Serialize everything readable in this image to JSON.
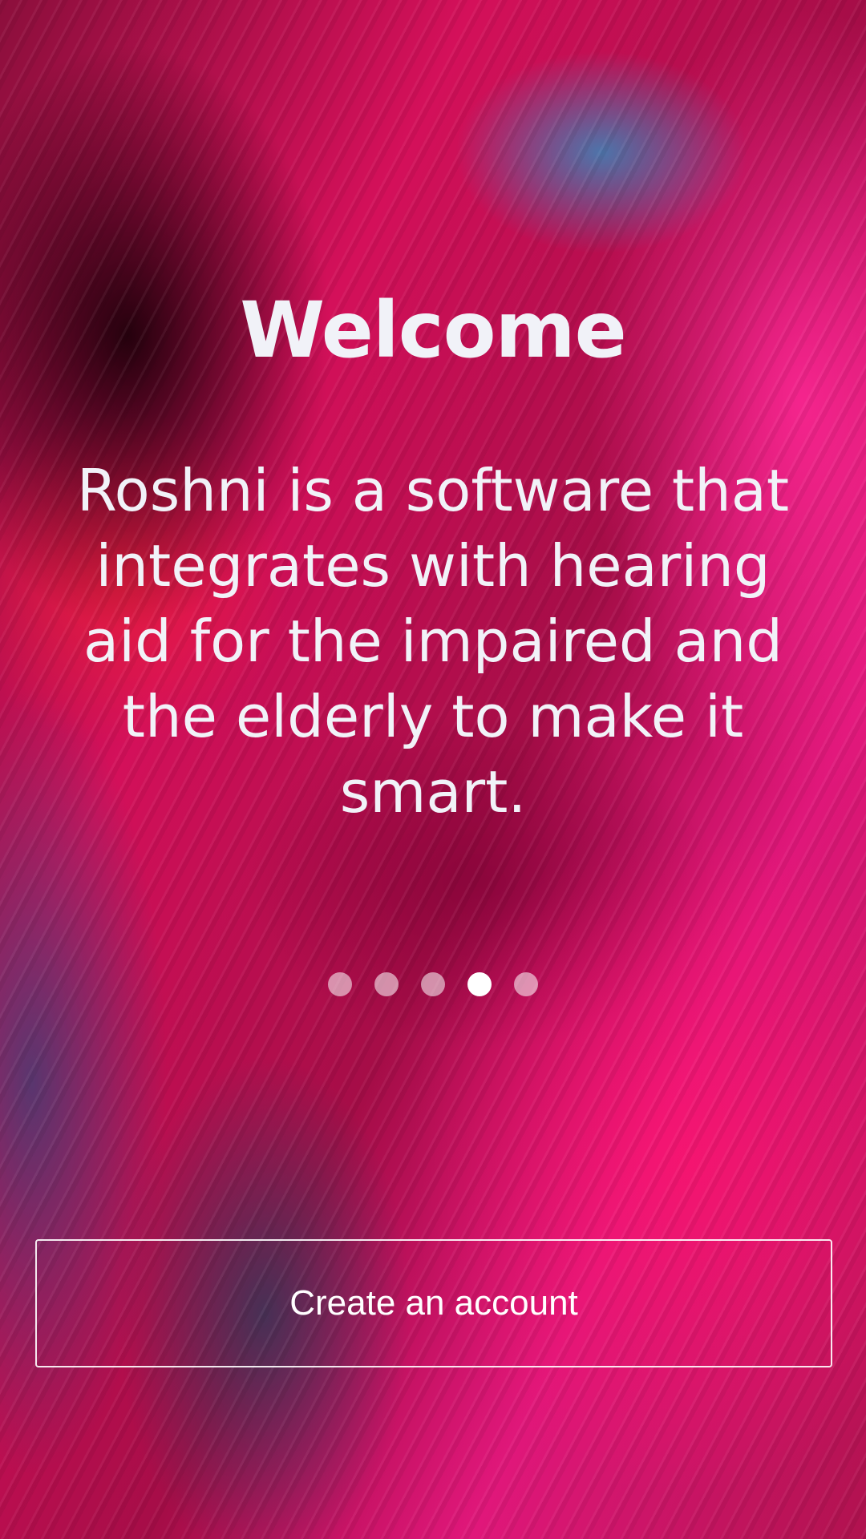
{
  "welcome": {
    "title": "Welcome",
    "description": "Roshni is a software that integrates with hearing aid for the impaired and the elderly to make it smart."
  },
  "pagination": {
    "total": 5,
    "active_index": 3
  },
  "actions": {
    "create_account_label": "Create an account"
  },
  "colors": {
    "text": "#f1f2f8",
    "dot_active": "#ffffff",
    "dot_inactive": "rgba(255,255,255,0.55)",
    "background_accent": "#d4105a"
  }
}
